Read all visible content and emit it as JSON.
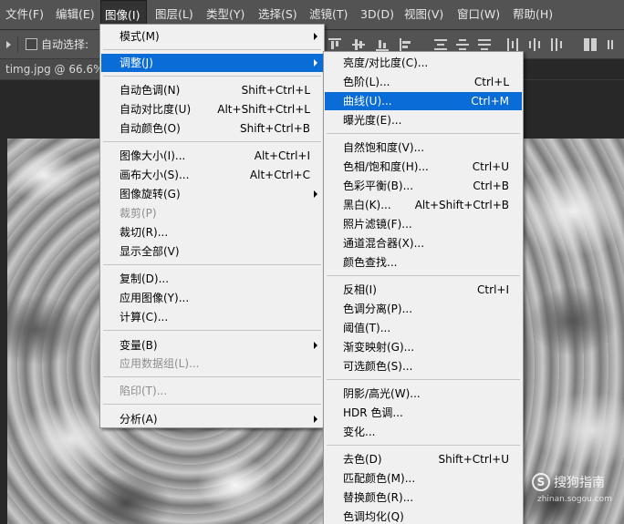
{
  "menubar": {
    "items": [
      "文件(F)",
      "编辑(E)",
      "图像(I)",
      "图层(L)",
      "类型(Y)",
      "选择(S)",
      "滤镜(T)",
      "3D(D)",
      "视图(V)",
      "窗口(W)",
      "帮助(H)"
    ],
    "active": "图像(I)"
  },
  "options": {
    "auto_select_label": "自动选择:"
  },
  "document": {
    "tab_title": "timg.jpg @ 66.6%"
  },
  "image_menu": {
    "items": [
      {
        "label": "模式(M)",
        "shortcut": "",
        "submenu": true
      },
      {
        "label": "调整(J)",
        "shortcut": "",
        "submenu": true,
        "highlighted": true
      },
      {
        "label": "自动色调(N)",
        "shortcut": "Shift+Ctrl+L"
      },
      {
        "label": "自动对比度(U)",
        "shortcut": "Alt+Shift+Ctrl+L"
      },
      {
        "label": "自动颜色(O)",
        "shortcut": "Shift+Ctrl+B"
      },
      {
        "label": "图像大小(I)...",
        "shortcut": "Alt+Ctrl+I"
      },
      {
        "label": "画布大小(S)...",
        "shortcut": "Alt+Ctrl+C"
      },
      {
        "label": "图像旋转(G)",
        "shortcut": "",
        "submenu": true
      },
      {
        "label": "裁剪(P)",
        "shortcut": "",
        "disabled": true
      },
      {
        "label": "裁切(R)...",
        "shortcut": ""
      },
      {
        "label": "显示全部(V)",
        "shortcut": ""
      },
      {
        "label": "复制(D)...",
        "shortcut": ""
      },
      {
        "label": "应用图像(Y)...",
        "shortcut": ""
      },
      {
        "label": "计算(C)...",
        "shortcut": ""
      },
      {
        "label": "变量(B)",
        "shortcut": "",
        "submenu": true
      },
      {
        "label": "应用数据组(L)...",
        "shortcut": "",
        "disabled": true
      },
      {
        "label": "陷印(T)...",
        "shortcut": "",
        "disabled": true
      },
      {
        "label": "分析(A)",
        "shortcut": "",
        "submenu": true
      }
    ]
  },
  "adjust_menu": {
    "items": [
      {
        "label": "亮度/对比度(C)...",
        "shortcut": ""
      },
      {
        "label": "色阶(L)...",
        "shortcut": "Ctrl+L"
      },
      {
        "label": "曲线(U)...",
        "shortcut": "Ctrl+M",
        "highlighted": true
      },
      {
        "label": "曝光度(E)...",
        "shortcut": ""
      },
      {
        "label": "自然饱和度(V)...",
        "shortcut": ""
      },
      {
        "label": "色相/饱和度(H)...",
        "shortcut": "Ctrl+U"
      },
      {
        "label": "色彩平衡(B)...",
        "shortcut": "Ctrl+B"
      },
      {
        "label": "黑白(K)...",
        "shortcut": "Alt+Shift+Ctrl+B"
      },
      {
        "label": "照片滤镜(F)...",
        "shortcut": ""
      },
      {
        "label": "通道混合器(X)...",
        "shortcut": ""
      },
      {
        "label": "颜色查找...",
        "shortcut": ""
      },
      {
        "label": "反相(I)",
        "shortcut": "Ctrl+I"
      },
      {
        "label": "色调分离(P)...",
        "shortcut": ""
      },
      {
        "label": "阈值(T)...",
        "shortcut": ""
      },
      {
        "label": "渐变映射(G)...",
        "shortcut": ""
      },
      {
        "label": "可选颜色(S)...",
        "shortcut": ""
      },
      {
        "label": "阴影/高光(W)...",
        "shortcut": ""
      },
      {
        "label": "HDR 色调...",
        "shortcut": ""
      },
      {
        "label": "变化...",
        "shortcut": ""
      },
      {
        "label": "去色(D)",
        "shortcut": "Shift+Ctrl+U"
      },
      {
        "label": "匹配颜色(M)...",
        "shortcut": ""
      },
      {
        "label": "替换颜色(R)...",
        "shortcut": ""
      },
      {
        "label": "色调均化(Q)",
        "shortcut": ""
      }
    ]
  },
  "watermark": {
    "logo": "S",
    "text": "搜狗指南",
    "url": "zhinan.sogou.com"
  }
}
